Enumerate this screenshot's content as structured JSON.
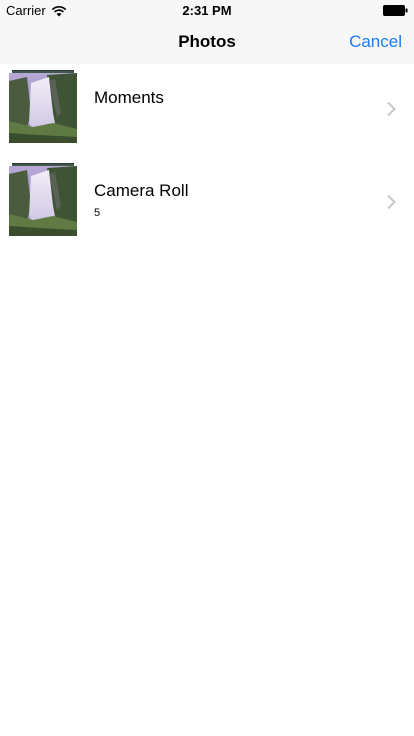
{
  "status_bar": {
    "carrier": "Carrier",
    "time": "2:31 PM",
    "icons": [
      "wifi-icon",
      "battery-icon"
    ]
  },
  "nav": {
    "title": "Photos",
    "cancel_label": "Cancel",
    "accent_color": "#1a7cf6"
  },
  "albums": [
    {
      "title": "Moments",
      "count": ""
    },
    {
      "title": "Camera Roll",
      "count": "5"
    }
  ]
}
